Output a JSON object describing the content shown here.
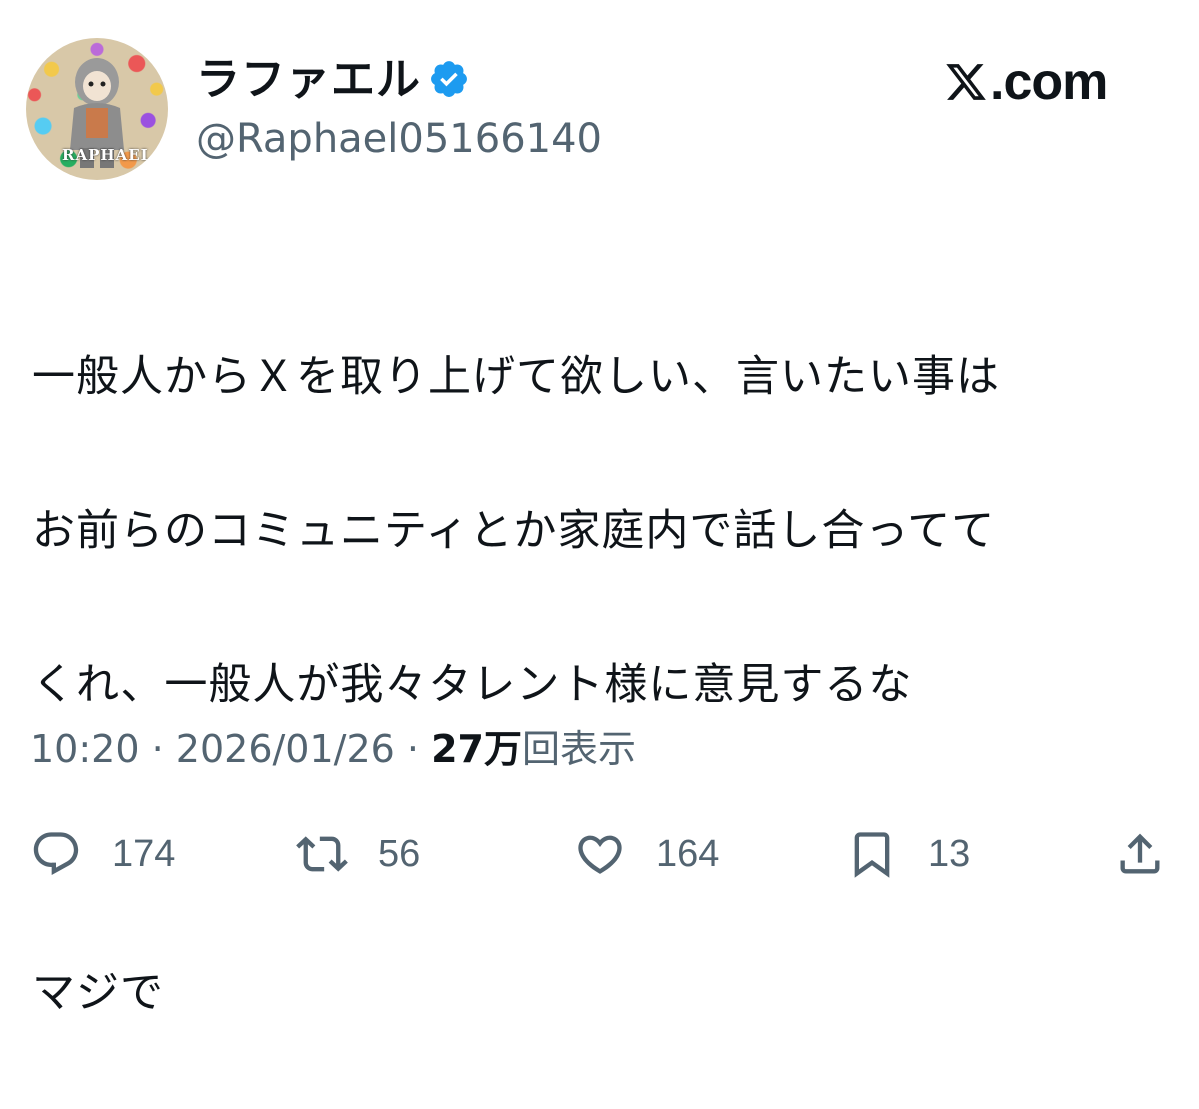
{
  "header": {
    "display_name": "ラファエル",
    "handle": "@Raphael05166140",
    "avatar_text": "RAPHAEL",
    "brand": "𝕏.com",
    "brand_text": ".com"
  },
  "tweet": {
    "lines": [
      "一般人からＸを取り上げて欲しい、言いたい事は",
      "お前らのコミュニティとか家庭内で話し合ってて",
      "くれ、一般人が我々タレント様に意見するな",
      "",
      "マジで"
    ]
  },
  "meta": {
    "time": "10:20",
    "separator": "·",
    "date": "2026/01/26",
    "views_count": "27万",
    "views_label": "回表示"
  },
  "actions": {
    "reply_count": "174",
    "repost_count": "56",
    "like_count": "164",
    "bookmark_count": "13"
  },
  "icons": {
    "verified": "verified-badge-icon",
    "reply": "reply-icon",
    "repost": "repost-icon",
    "like": "like-icon",
    "bookmark": "bookmark-icon",
    "share": "share-icon"
  },
  "colors": {
    "verified": "#1d9bf0",
    "text": "#0f1419",
    "secondary": "#536471"
  }
}
